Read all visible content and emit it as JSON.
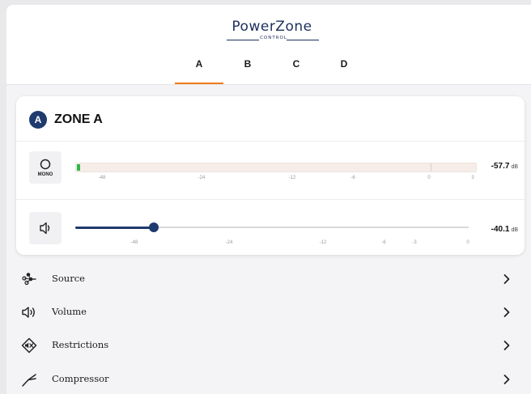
{
  "header": {
    "logo_main": "PowerZone",
    "logo_sub": "CONTROL",
    "tabs": [
      {
        "label": "A",
        "active": true
      },
      {
        "label": "B",
        "active": false
      },
      {
        "label": "C",
        "active": false
      },
      {
        "label": "D",
        "active": false
      }
    ]
  },
  "zone": {
    "badge": "A",
    "title": "ZONE A",
    "meter": {
      "mode_label": "MONO",
      "ticks": [
        "-48",
        "-24",
        "-12",
        "-6",
        "0",
        "3"
      ],
      "level_fraction": 0.008,
      "value": "-57.7",
      "unit": "dB"
    },
    "volume": {
      "ticks": [
        "-48",
        "-24",
        "-12",
        "-6",
        "-3",
        "0"
      ],
      "level_fraction": 0.2,
      "value": "-40.1",
      "unit": "dB"
    }
  },
  "menu": {
    "items": [
      {
        "label": "Source",
        "icon": "source-icon"
      },
      {
        "label": "Volume",
        "icon": "volume-icon"
      },
      {
        "label": "Restrictions",
        "icon": "restrictions-icon"
      },
      {
        "label": "Compressor",
        "icon": "compressor-icon"
      }
    ]
  },
  "colors": {
    "brand_navy": "#1f3a6e",
    "tab_active": "#f27a1a",
    "meter_green": "#2fb84a"
  }
}
